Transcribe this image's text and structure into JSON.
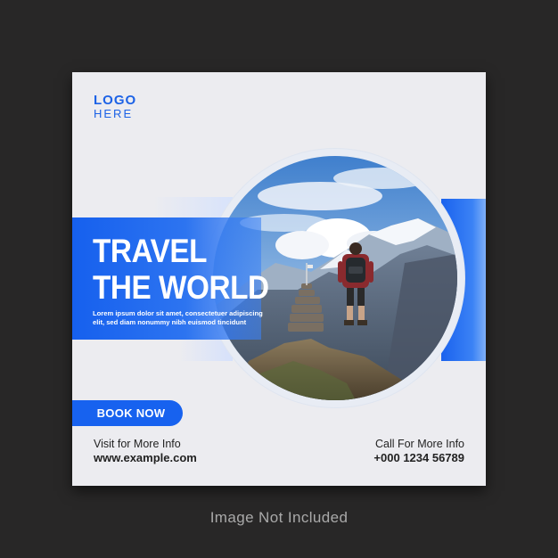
{
  "logo": {
    "line1": "LOGO",
    "line2": "HERE"
  },
  "headline": {
    "line1": "TRAVEL",
    "line2": "THE WORLD"
  },
  "body_text": {
    "line1": "Lorem ipsum dolor sit amet, consectetuer adipiscing",
    "line2": "elit, sed diam nonummy nibh euismod tincidunt"
  },
  "cta": {
    "label": "BOOK NOW"
  },
  "contact": {
    "visit_label": "Visit for More Info",
    "website": "www.example.com",
    "call_label": "Call For More Info",
    "phone": "+000 1234 56789"
  },
  "caption": "Image Not Included",
  "colors": {
    "accent": "#1762ef",
    "background": "#282727",
    "card": "#ececf0"
  }
}
